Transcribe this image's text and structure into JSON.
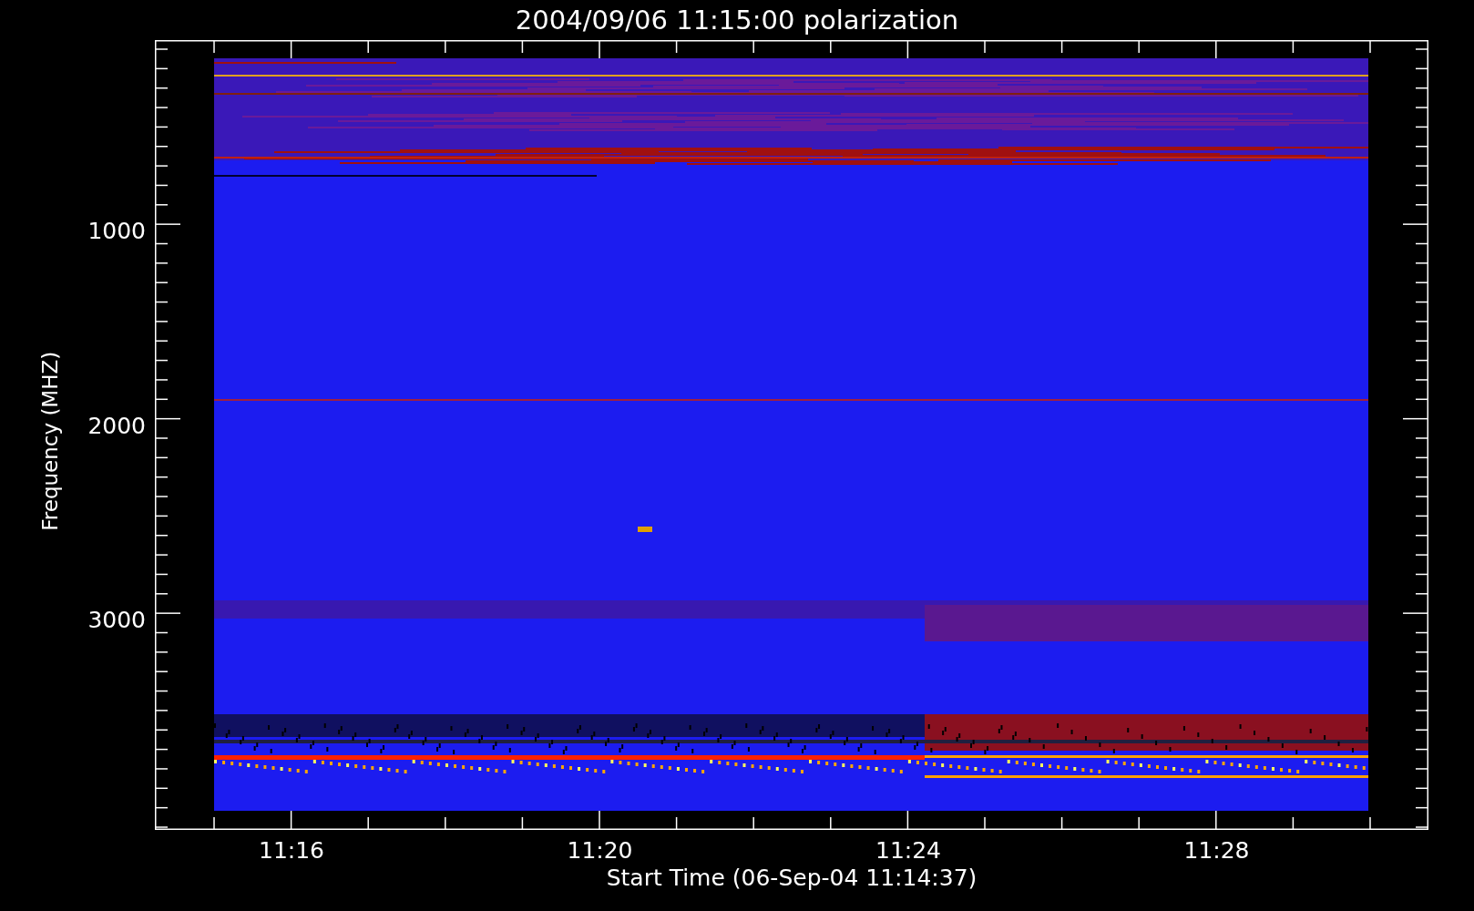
{
  "title": "2004/09/06 11:15:00 polarization",
  "y_axis": {
    "label": "Frequency (MHZ)",
    "ticks": [
      "1000",
      "2000",
      "3000"
    ]
  },
  "x_axis": {
    "label": "Start Time (06-Sep-04 11:14:37)",
    "ticks": [
      "11:16",
      "11:20",
      "11:24",
      "11:28"
    ]
  }
}
